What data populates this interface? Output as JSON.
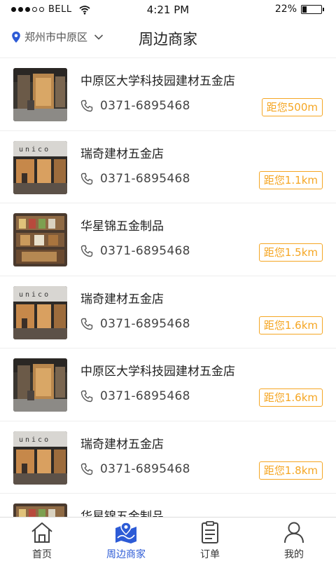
{
  "status_bar": {
    "carrier": "BELL",
    "time": "4:21 PM",
    "battery": "22%",
    "battery_level": 0.22
  },
  "header": {
    "location": "郑州市中原区",
    "title": "周边商家"
  },
  "shops": [
    {
      "name": "中原区大学科技园建材五金店",
      "phone": "0371-6895468",
      "distance": "距您500m",
      "image": "shop-interior-photo"
    },
    {
      "name": "瑞奇建材五金店",
      "phone": "0371-6895468",
      "distance": "距您1.1km",
      "image": "unico-storefront-photo"
    },
    {
      "name": "华星锦五金制品",
      "phone": "0371-6895468",
      "distance": "距您1.5km",
      "image": "shelves-photo"
    },
    {
      "name": "瑞奇建材五金店",
      "phone": "0371-6895468",
      "distance": "距您1.6km",
      "image": "unico-storefront-photo"
    },
    {
      "name": "中原区大学科技园建材五金店",
      "phone": "0371-6895468",
      "distance": "距您1.6km",
      "image": "shop-interior-photo"
    },
    {
      "name": "瑞奇建材五金店",
      "phone": "0371-6895468",
      "distance": "距您1.8km",
      "image": "unico-storefront-photo"
    },
    {
      "name": "华星锦五金制品",
      "phone": "",
      "distance": "",
      "image": "shelves-photo"
    }
  ],
  "tabbar": {
    "tabs": [
      {
        "label": "首页",
        "icon": "home-icon"
      },
      {
        "label": "周边商家",
        "icon": "map-location-icon"
      },
      {
        "label": "订单",
        "icon": "order-list-icon"
      },
      {
        "label": "我的",
        "icon": "user-icon"
      }
    ],
    "active_color": "#2d5bd6"
  },
  "colors": {
    "accent": "#f5a623",
    "active_tab": "#2d5bd6"
  }
}
